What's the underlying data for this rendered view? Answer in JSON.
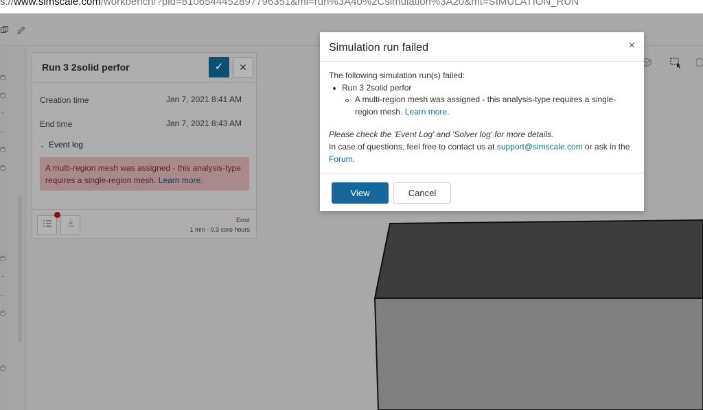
{
  "browser": {
    "url_scheme": "s://",
    "url_host": "www.simscale.com",
    "url_rest": "/workbench/?pid=8106544452897796351&mi=run%3A40%2Csimulation%3A20&mt=SIMULATION_RUN"
  },
  "toolbar": {
    "icons": [
      "copy-icon",
      "pencil-icon"
    ]
  },
  "viewport": {
    "icons": [
      "cube-view-icon",
      "box-select-icon",
      "cube-outline-icon"
    ],
    "box_colors": {
      "top": "#3d3d3d",
      "front": "#808080",
      "edge": "#111111"
    }
  },
  "run_panel": {
    "title": "Run 3 2solid perfor",
    "creation_label": "Creation time",
    "creation_value": "Jan 7, 2021 8:41 AM",
    "end_label": "End time",
    "end_value": "Jan 7, 2021 8:43 AM",
    "event_log_label": "Event log",
    "error_text": "A multi-region mesh was assigned - this analysis-type requires a single-region mesh.",
    "error_link": "Learn more",
    "error_suffix": ".",
    "status": "Error",
    "duration": "1 min - 0.3 core hours"
  },
  "modal": {
    "title": "Simulation run failed",
    "close_glyph": "×",
    "intro": "The following simulation run(s) failed:",
    "run_name": "Run 3 2solid perfor",
    "error_text": "A multi-region mesh was assigned - this analysis-type requires a single-region mesh.",
    "error_link": "Learn more",
    "error_suffix": ".",
    "check_note": "Please check the 'Event Log' and 'Solver log' for more details.",
    "contact_prefix": "In case of questions, feel free to contact us at ",
    "contact_email": "support@simscale.com",
    "contact_middle": " or ask in the",
    "forum_link": "Forum",
    "forum_suffix": ".",
    "view_label": "View",
    "cancel_label": "Cancel"
  },
  "colors": {
    "accent": "#16679c",
    "error_bg": "#a98a8b",
    "error_text": "#5e1e22"
  }
}
